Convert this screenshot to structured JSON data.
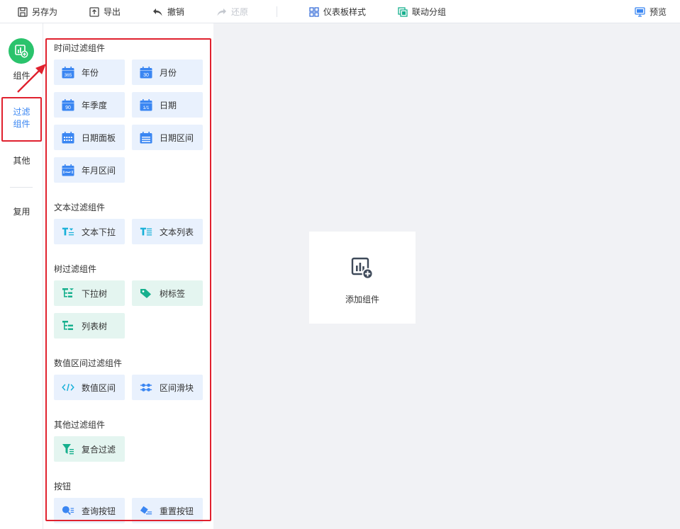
{
  "toolbar": {
    "save_as": "另存为",
    "export": "导出",
    "undo": "撤销",
    "redo": "还原",
    "dashboard_style": "仪表板样式",
    "linkage_group": "联动分组",
    "preview": "预览"
  },
  "rail": {
    "component": "组件",
    "filter_line1": "过滤",
    "filter_line2": "组件",
    "other": "其他",
    "reuse": "复用"
  },
  "panel": {
    "sections": [
      {
        "title": "时间过滤组件",
        "items": [
          "年份",
          "月份",
          "年季度",
          "日期",
          "日期面板",
          "日期区间",
          "年月区间"
        ]
      },
      {
        "title": "文本过滤组件",
        "items": [
          "文本下拉",
          "文本列表"
        ]
      },
      {
        "title": "树过滤组件",
        "items": [
          "下拉树",
          "树标签",
          "列表树"
        ]
      },
      {
        "title": "数值区间过滤组件",
        "items": [
          "数值区间",
          "区间滑块"
        ]
      },
      {
        "title": "其他过滤组件",
        "items": [
          "复合过滤"
        ]
      },
      {
        "title": "按钮",
        "items": [
          "查询按钮",
          "重置按钮"
        ]
      }
    ]
  },
  "calendar_icon_labels": {
    "year": "365",
    "month": "30",
    "quarter": "90",
    "day": "1/1"
  },
  "canvas": {
    "add_component": "添加组件"
  },
  "colors": {
    "accent_blue": "#3a86f2",
    "green": "#2ac36c",
    "teal": "#17b08e",
    "highlight_red": "#e0212e",
    "canvas_bg": "#f1f2f5"
  }
}
